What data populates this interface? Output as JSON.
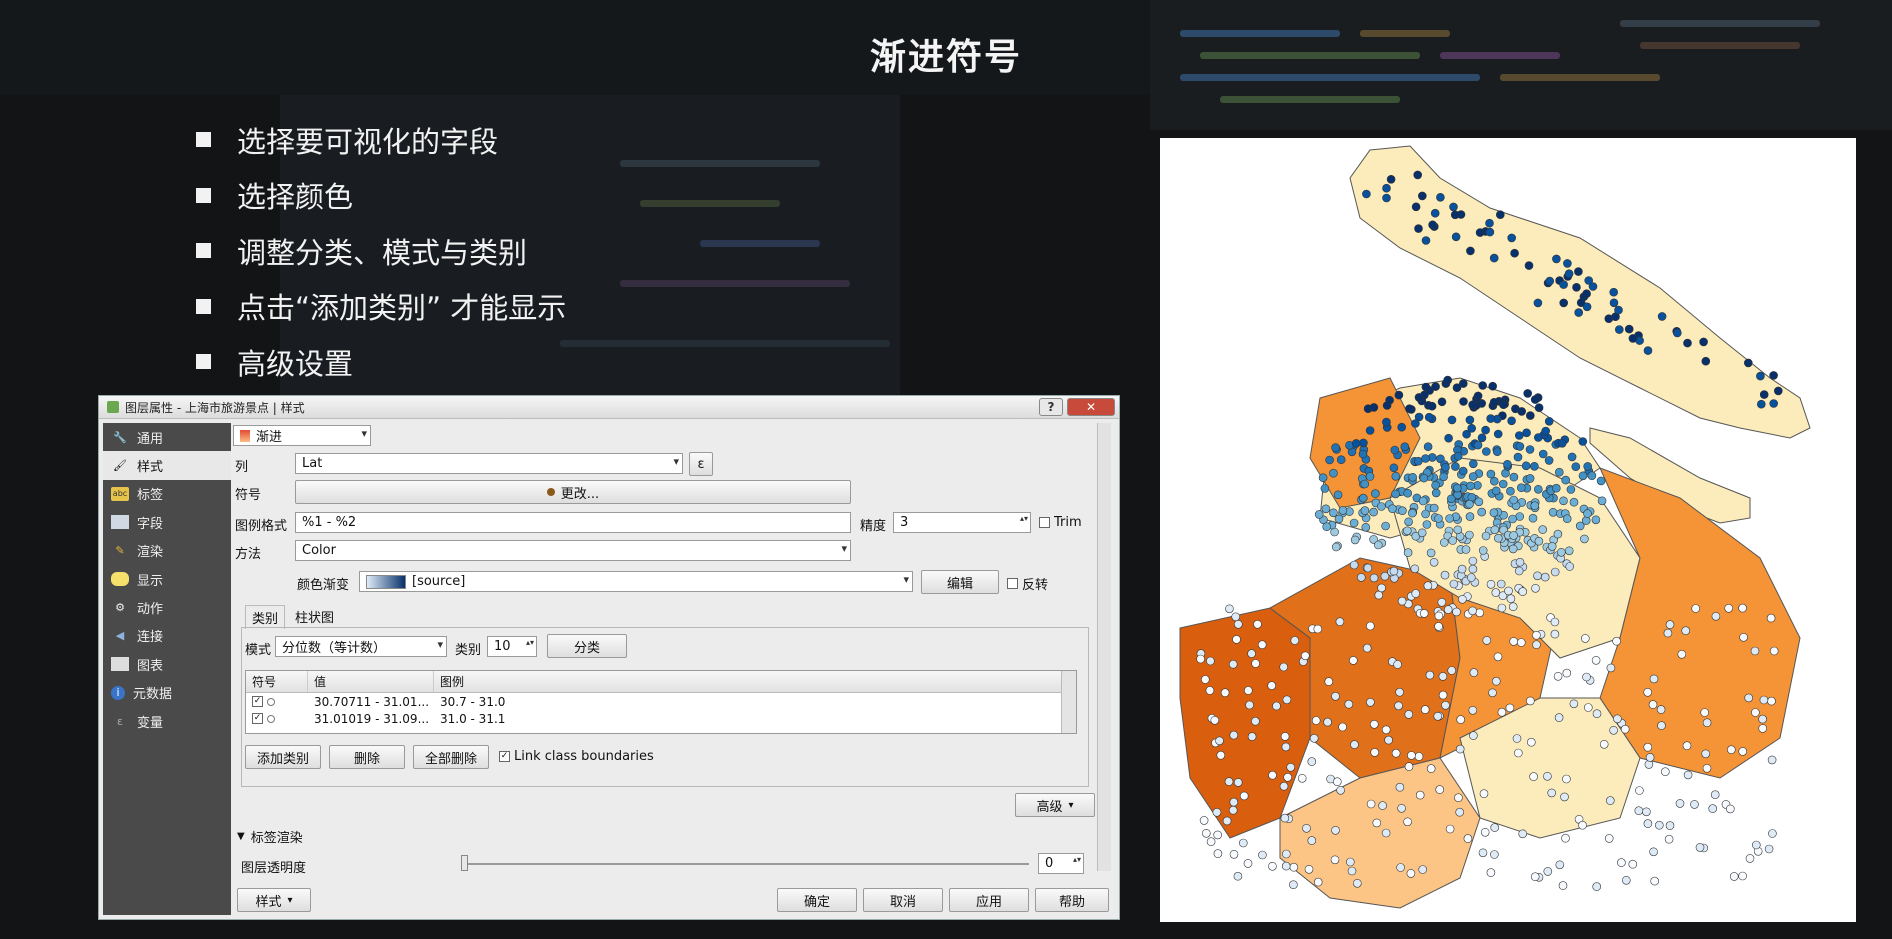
{
  "slide": {
    "title": "渐进符号",
    "bullets": [
      "选择要可视化的字段",
      "选择颜色",
      "调整分类、模式与类别",
      "点击“添加类别” 才能显示",
      "高级设置"
    ]
  },
  "dialog": {
    "title": "图层属性 - 上海市旅游景点 | 样式",
    "sidebar": [
      {
        "label": "通用",
        "icon": "wrench-icon"
      },
      {
        "label": "样式",
        "icon": "paintbrush-icon"
      },
      {
        "label": "标签",
        "icon": "abc-label-icon"
      },
      {
        "label": "字段",
        "icon": "table-icon"
      },
      {
        "label": "渲染",
        "icon": "brush-icon"
      },
      {
        "label": "显示",
        "icon": "speech-bubble-icon"
      },
      {
        "label": "动作",
        "icon": "gear-icon"
      },
      {
        "label": "连接",
        "icon": "join-icon"
      },
      {
        "label": "图表",
        "icon": "chart-icon"
      },
      {
        "label": "元数据",
        "icon": "info-icon"
      },
      {
        "label": "变量",
        "icon": "variable-icon"
      }
    ],
    "active_sidebar_index": 1,
    "renderer_type": "渐进",
    "column_label": "列",
    "column_value": "Lat",
    "expression_button": "ε",
    "symbol_label": "符号",
    "symbol_button": "更改...",
    "legend_format_label": "图例格式",
    "legend_format_value": "%1 - %2",
    "precision_label": "精度",
    "precision_value": "3",
    "trim_label": "Trim",
    "method_label": "方法",
    "method_value": "Color",
    "color_ramp_label": "颜色渐变",
    "color_ramp_value": "[source]",
    "edit_button": "编辑",
    "invert_label": "反转",
    "tabs": [
      "类别",
      "柱状图"
    ],
    "mode_label": "模式",
    "mode_value": "分位数（等计数）",
    "classes_label": "类别",
    "classes_value": "10",
    "classify_button": "分类",
    "table_headers": [
      "符号",
      "值",
      "图例"
    ],
    "table_rows": [
      {
        "value": "30.70711 - 31.01...",
        "legend": "30.7 - 31.0"
      },
      {
        "value": "31.01019 - 31.09...",
        "legend": "31.0 - 31.1"
      }
    ],
    "add_class_button": "添加类别",
    "delete_button": "删除",
    "delete_all_button": "全部删除",
    "link_boundaries_label": "Link class boundaries",
    "advanced_button": "高级",
    "layer_rendering_label": "标签渲染",
    "opacity_label": "图层透明度",
    "opacity_value": "0",
    "style_button": "样式",
    "ok_button": "确定",
    "cancel_button": "取消",
    "apply_button": "应用",
    "help_button": "帮助",
    "help_title_button": "?"
  },
  "colors": {
    "slide_bg": "#121416",
    "dialog_bg": "#ececec",
    "sidebar_bg": "#4a4a4a",
    "ramp_start": "#deebf7",
    "ramp_end": "#08306b",
    "map_orange_dark": "#d95f0e",
    "map_orange_mid": "#f59436",
    "map_orange_light": "#fdc585",
    "map_cream": "#fcecbc"
  }
}
